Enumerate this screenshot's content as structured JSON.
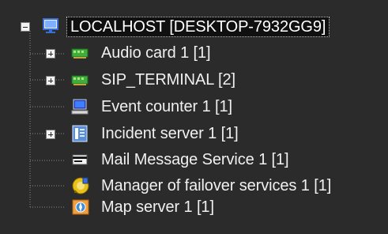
{
  "tree": {
    "root": {
      "label": "LOCALHOST [DESKTOP-7932GG9]",
      "icon": "monitor-icon",
      "expanded": true,
      "selected": true
    },
    "children": [
      {
        "label": "Audio card 1 [1]",
        "icon": "audio-card-icon",
        "expandable": true,
        "expanded": false
      },
      {
        "label": "SIP_TERMINAL [2]",
        "icon": "sip-terminal-icon",
        "expandable": true,
        "expanded": false
      },
      {
        "label": "Event counter 1 [1]",
        "icon": "computer-icon",
        "expandable": false
      },
      {
        "label": "Incident server 1 [1]",
        "icon": "incident-server-icon",
        "expandable": true,
        "expanded": false
      },
      {
        "label": "Mail Message Service 1 [1]",
        "icon": "mail-icon",
        "expandable": false
      },
      {
        "label": "Manager of failover services 1 [1]",
        "icon": "failover-manager-icon",
        "expandable": false
      },
      {
        "label": "Map server 1 [1]",
        "icon": "map-server-icon",
        "expandable": false
      }
    ]
  },
  "colors": {
    "background": "#2b2b2b",
    "text": "#f0f0f0",
    "selection_bg": "#101010",
    "tree_line": "#8a8a8a"
  }
}
